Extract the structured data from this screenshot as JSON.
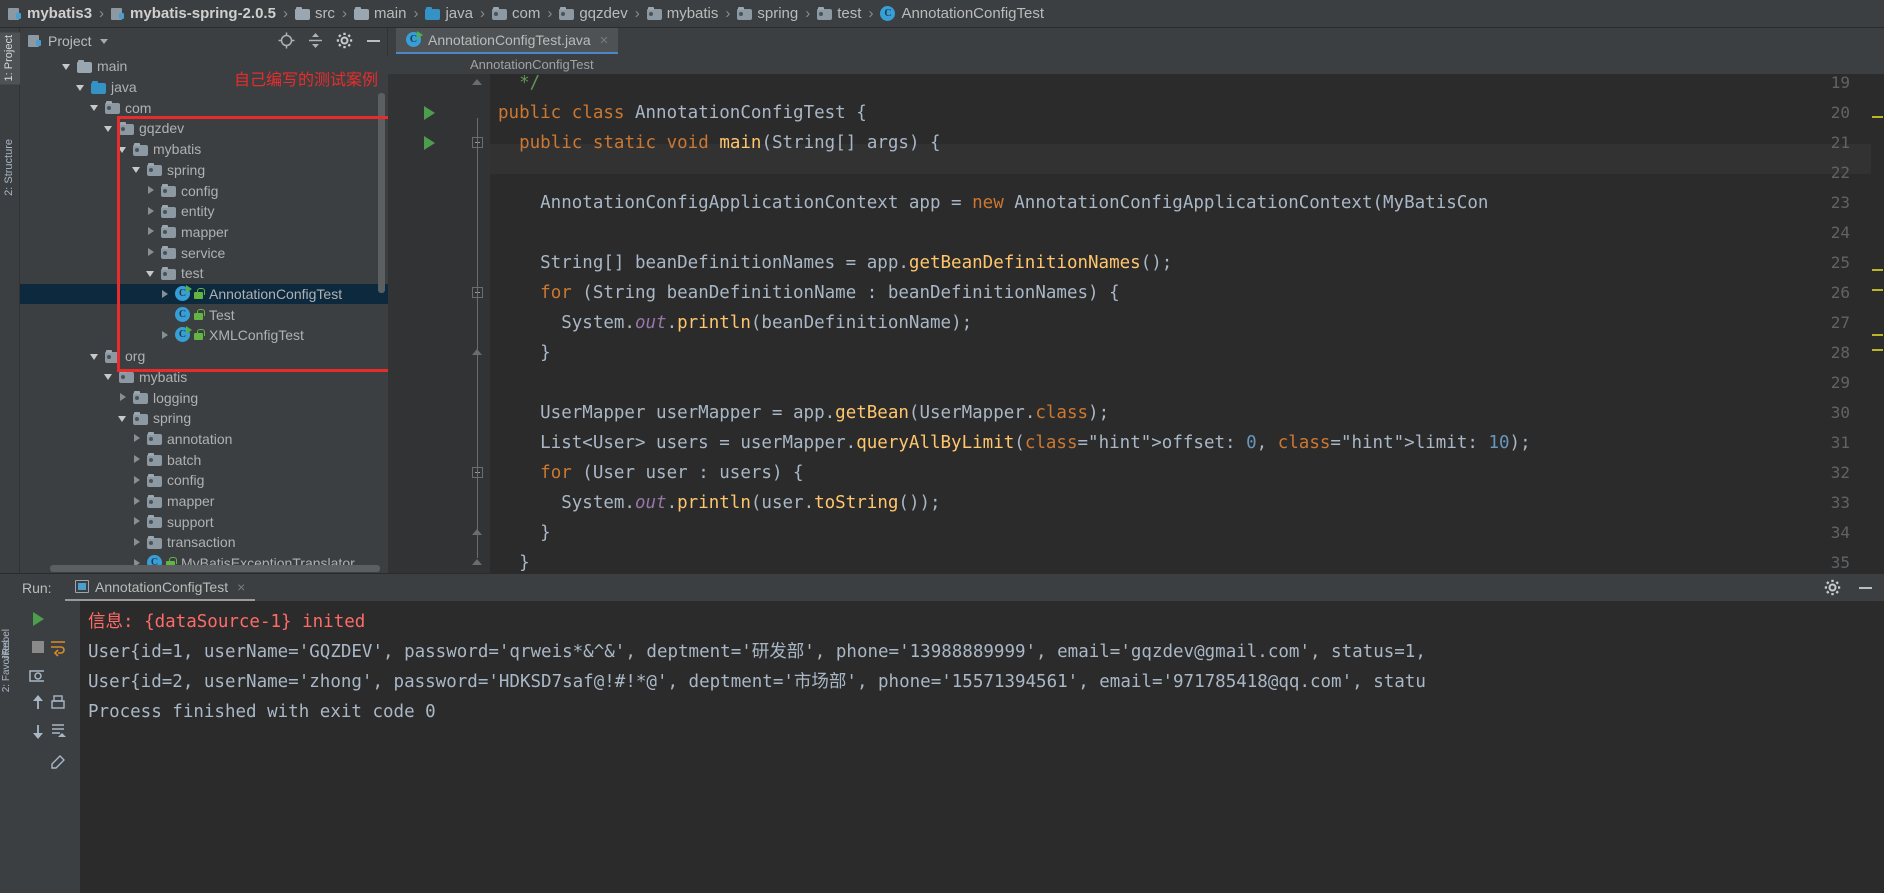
{
  "breadcrumb": {
    "items": [
      {
        "label": "mybatis3",
        "icon": "module-icon",
        "bold": true
      },
      {
        "label": "mybatis-spring-2.0.5",
        "icon": "module-icon",
        "bold": true
      },
      {
        "label": "src",
        "icon": "folder-icon",
        "bold": false
      },
      {
        "label": "main",
        "icon": "folder-icon",
        "bold": false
      },
      {
        "label": "java",
        "icon": "source-folder-icon",
        "bold": false
      },
      {
        "label": "com",
        "icon": "package-icon",
        "bold": false
      },
      {
        "label": "gqzdev",
        "icon": "package-icon",
        "bold": false
      },
      {
        "label": "mybatis",
        "icon": "package-icon",
        "bold": false
      },
      {
        "label": "spring",
        "icon": "package-icon",
        "bold": false
      },
      {
        "label": "test",
        "icon": "package-icon",
        "bold": false
      },
      {
        "label": "AnnotationConfigTest",
        "icon": "java-class-icon",
        "bold": false
      }
    ],
    "separator": "›"
  },
  "left_tool_strip": {
    "tabs": [
      {
        "label": "1: Project",
        "active": true
      },
      {
        "label": "2: Structure",
        "active": false
      }
    ]
  },
  "project_panel": {
    "title": "Project",
    "dropdown_icon": "chevron-down-icon",
    "header_icons": [
      "locate-target-icon",
      "collapse-all-icon",
      "settings-gear-icon",
      "minimize-icon"
    ],
    "annotation": "自己编写的测试案例",
    "annotation_color": "#e82c2c",
    "tree": [
      {
        "label": "main",
        "depth": 2,
        "arrow": "open",
        "icon": "folder-icon",
        "selected": false
      },
      {
        "label": "java",
        "depth": 3,
        "arrow": "open",
        "icon": "source-folder-icon",
        "selected": false
      },
      {
        "label": "com",
        "depth": 4,
        "arrow": "open",
        "icon": "package-icon",
        "selected": false
      },
      {
        "label": "gqzdev",
        "depth": 5,
        "arrow": "open",
        "icon": "package-icon",
        "selected": false
      },
      {
        "label": "mybatis",
        "depth": 6,
        "arrow": "open",
        "icon": "package-icon",
        "selected": false
      },
      {
        "label": "spring",
        "depth": 7,
        "arrow": "open",
        "icon": "package-icon",
        "selected": false
      },
      {
        "label": "config",
        "depth": 8,
        "arrow": "closed",
        "icon": "package-icon",
        "selected": false
      },
      {
        "label": "entity",
        "depth": 8,
        "arrow": "closed",
        "icon": "package-icon",
        "selected": false
      },
      {
        "label": "mapper",
        "depth": 8,
        "arrow": "closed",
        "icon": "package-icon",
        "selected": false
      },
      {
        "label": "service",
        "depth": 8,
        "arrow": "closed",
        "icon": "package-icon",
        "selected": false
      },
      {
        "label": "test",
        "depth": 8,
        "arrow": "open",
        "icon": "package-icon",
        "selected": false
      },
      {
        "label": "AnnotationConfigTest",
        "depth": 9,
        "arrow": "closed",
        "icon": "java-runnable-class-icon",
        "lock": true,
        "selected": true
      },
      {
        "label": "Test",
        "depth": 9,
        "arrow": "none",
        "icon": "java-class-icon",
        "lock": true,
        "selected": false
      },
      {
        "label": "XMLConfigTest",
        "depth": 9,
        "arrow": "closed",
        "icon": "java-runnable-class-icon",
        "lock": true,
        "selected": false
      },
      {
        "label": "org",
        "depth": 4,
        "arrow": "open",
        "icon": "package-icon",
        "selected": false
      },
      {
        "label": "mybatis",
        "depth": 5,
        "arrow": "open",
        "icon": "package-icon",
        "selected": false
      },
      {
        "label": "logging",
        "depth": 6,
        "arrow": "closed",
        "icon": "package-icon",
        "selected": false
      },
      {
        "label": "spring",
        "depth": 6,
        "arrow": "open",
        "icon": "package-icon",
        "selected": false
      },
      {
        "label": "annotation",
        "depth": 7,
        "arrow": "closed",
        "icon": "package-icon",
        "selected": false
      },
      {
        "label": "batch",
        "depth": 7,
        "arrow": "closed",
        "icon": "package-icon",
        "selected": false
      },
      {
        "label": "config",
        "depth": 7,
        "arrow": "closed",
        "icon": "package-icon",
        "selected": false
      },
      {
        "label": "mapper",
        "depth": 7,
        "arrow": "closed",
        "icon": "package-icon",
        "selected": false
      },
      {
        "label": "support",
        "depth": 7,
        "arrow": "closed",
        "icon": "package-icon",
        "selected": false
      },
      {
        "label": "transaction",
        "depth": 7,
        "arrow": "closed",
        "icon": "package-icon",
        "selected": false
      },
      {
        "label": "MyBatisExceptionTranslator",
        "depth": 7,
        "arrow": "closed",
        "icon": "java-class-icon",
        "lock": true,
        "selected": false
      }
    ]
  },
  "editor": {
    "tab": {
      "label": "AnnotationConfigTest.java",
      "icon": "java-runnable-class-icon",
      "close_icon": "×"
    },
    "breadcrumb": "AnnotationConfigTest",
    "first_line_number": 19,
    "lines": [
      {
        "n": 19,
        "runmark": false,
        "fold": "end",
        "code": "  */"
      },
      {
        "n": 20,
        "runmark": true,
        "fold": "none",
        "code": "public class AnnotationConfigTest {"
      },
      {
        "n": 21,
        "runmark": true,
        "fold": "start",
        "code": "  public static void main(String[] args) {"
      },
      {
        "n": 22,
        "runmark": false,
        "fold": "none",
        "code": ""
      },
      {
        "n": 23,
        "runmark": false,
        "fold": "none",
        "code": "    AnnotationConfigApplicationContext app = new AnnotationConfigApplicationContext(MyBatisCon"
      },
      {
        "n": 24,
        "runmark": false,
        "fold": "none",
        "code": ""
      },
      {
        "n": 25,
        "runmark": false,
        "fold": "none",
        "code": "    String[] beanDefinitionNames = app.getBeanDefinitionNames();"
      },
      {
        "n": 26,
        "runmark": false,
        "fold": "start",
        "code": "    for (String beanDefinitionName : beanDefinitionNames) {"
      },
      {
        "n": 27,
        "runmark": false,
        "fold": "none",
        "code": "      System.out.println(beanDefinitionName);"
      },
      {
        "n": 28,
        "runmark": false,
        "fold": "end",
        "code": "    }"
      },
      {
        "n": 29,
        "runmark": false,
        "fold": "none",
        "code": ""
      },
      {
        "n": 30,
        "runmark": false,
        "fold": "none",
        "code": "    UserMapper userMapper = app.getBean(UserMapper.class);"
      },
      {
        "n": 31,
        "runmark": false,
        "fold": "none",
        "code": "    List<User> users = userMapper.queryAllByLimit( offset: 0,  limit: 10);"
      },
      {
        "n": 32,
        "runmark": false,
        "fold": "start",
        "code": "    for (User user : users) {"
      },
      {
        "n": 33,
        "runmark": false,
        "fold": "none",
        "code": "      System.out.println(user.toString());"
      },
      {
        "n": 34,
        "runmark": false,
        "fold": "end",
        "code": "    }"
      },
      {
        "n": 35,
        "runmark": false,
        "fold": "end",
        "code": "  }"
      }
    ],
    "inlay_hints": [
      "offset:",
      "limit:"
    ]
  },
  "run_panel": {
    "label": "Run:",
    "tab": {
      "label": "AnnotationConfigTest",
      "icon": "run-config-icon",
      "close_icon": "×"
    },
    "header_icons": [
      "settings-gear-icon",
      "minimize-icon"
    ],
    "side_label": "JRebel",
    "toolbar_icons": [
      "rerun-icon",
      "stop-icon",
      "camera-icon",
      "up-arrow-icon",
      "down-arrow-icon",
      "soft-wrap-icon",
      "print-icon",
      "scroll-to-end-icon",
      "clear-all-icon"
    ],
    "console_lines": [
      {
        "text": "信息: {dataSource-1} inited",
        "color": "red"
      },
      {
        "text": "User{id=1, userName='GQZDEV', password='qrweis*&^&', deptment='研发部', phone='13988889999', email='gqzdev@gmail.com', status=1,",
        "color": "normal"
      },
      {
        "text": "User{id=2, userName='zhong', password='HDKSD7saf@!#!*@', deptment='市场部', phone='15571394561', email='971785418@qq.com', statu",
        "color": "normal"
      },
      {
        "text": "",
        "color": "normal"
      },
      {
        "text": "Process finished with exit code 0",
        "color": "normal"
      }
    ]
  },
  "bottom_left_icons": {
    "vertical_label": "2: Favorites"
  },
  "colors": {
    "panel_bg": "#3c3f41",
    "editor_bg": "#2b2b2b",
    "selection": "#0d293e",
    "annotation_red": "#e82c2c",
    "console_red": "#ff6b68",
    "keyword_orange": "#cc7832",
    "number_blue": "#6897bb",
    "string_green": "#6a8759",
    "method_yellow": "#ffc66d",
    "field_purple": "#9876aa",
    "text_default": "#a9b7c6"
  }
}
